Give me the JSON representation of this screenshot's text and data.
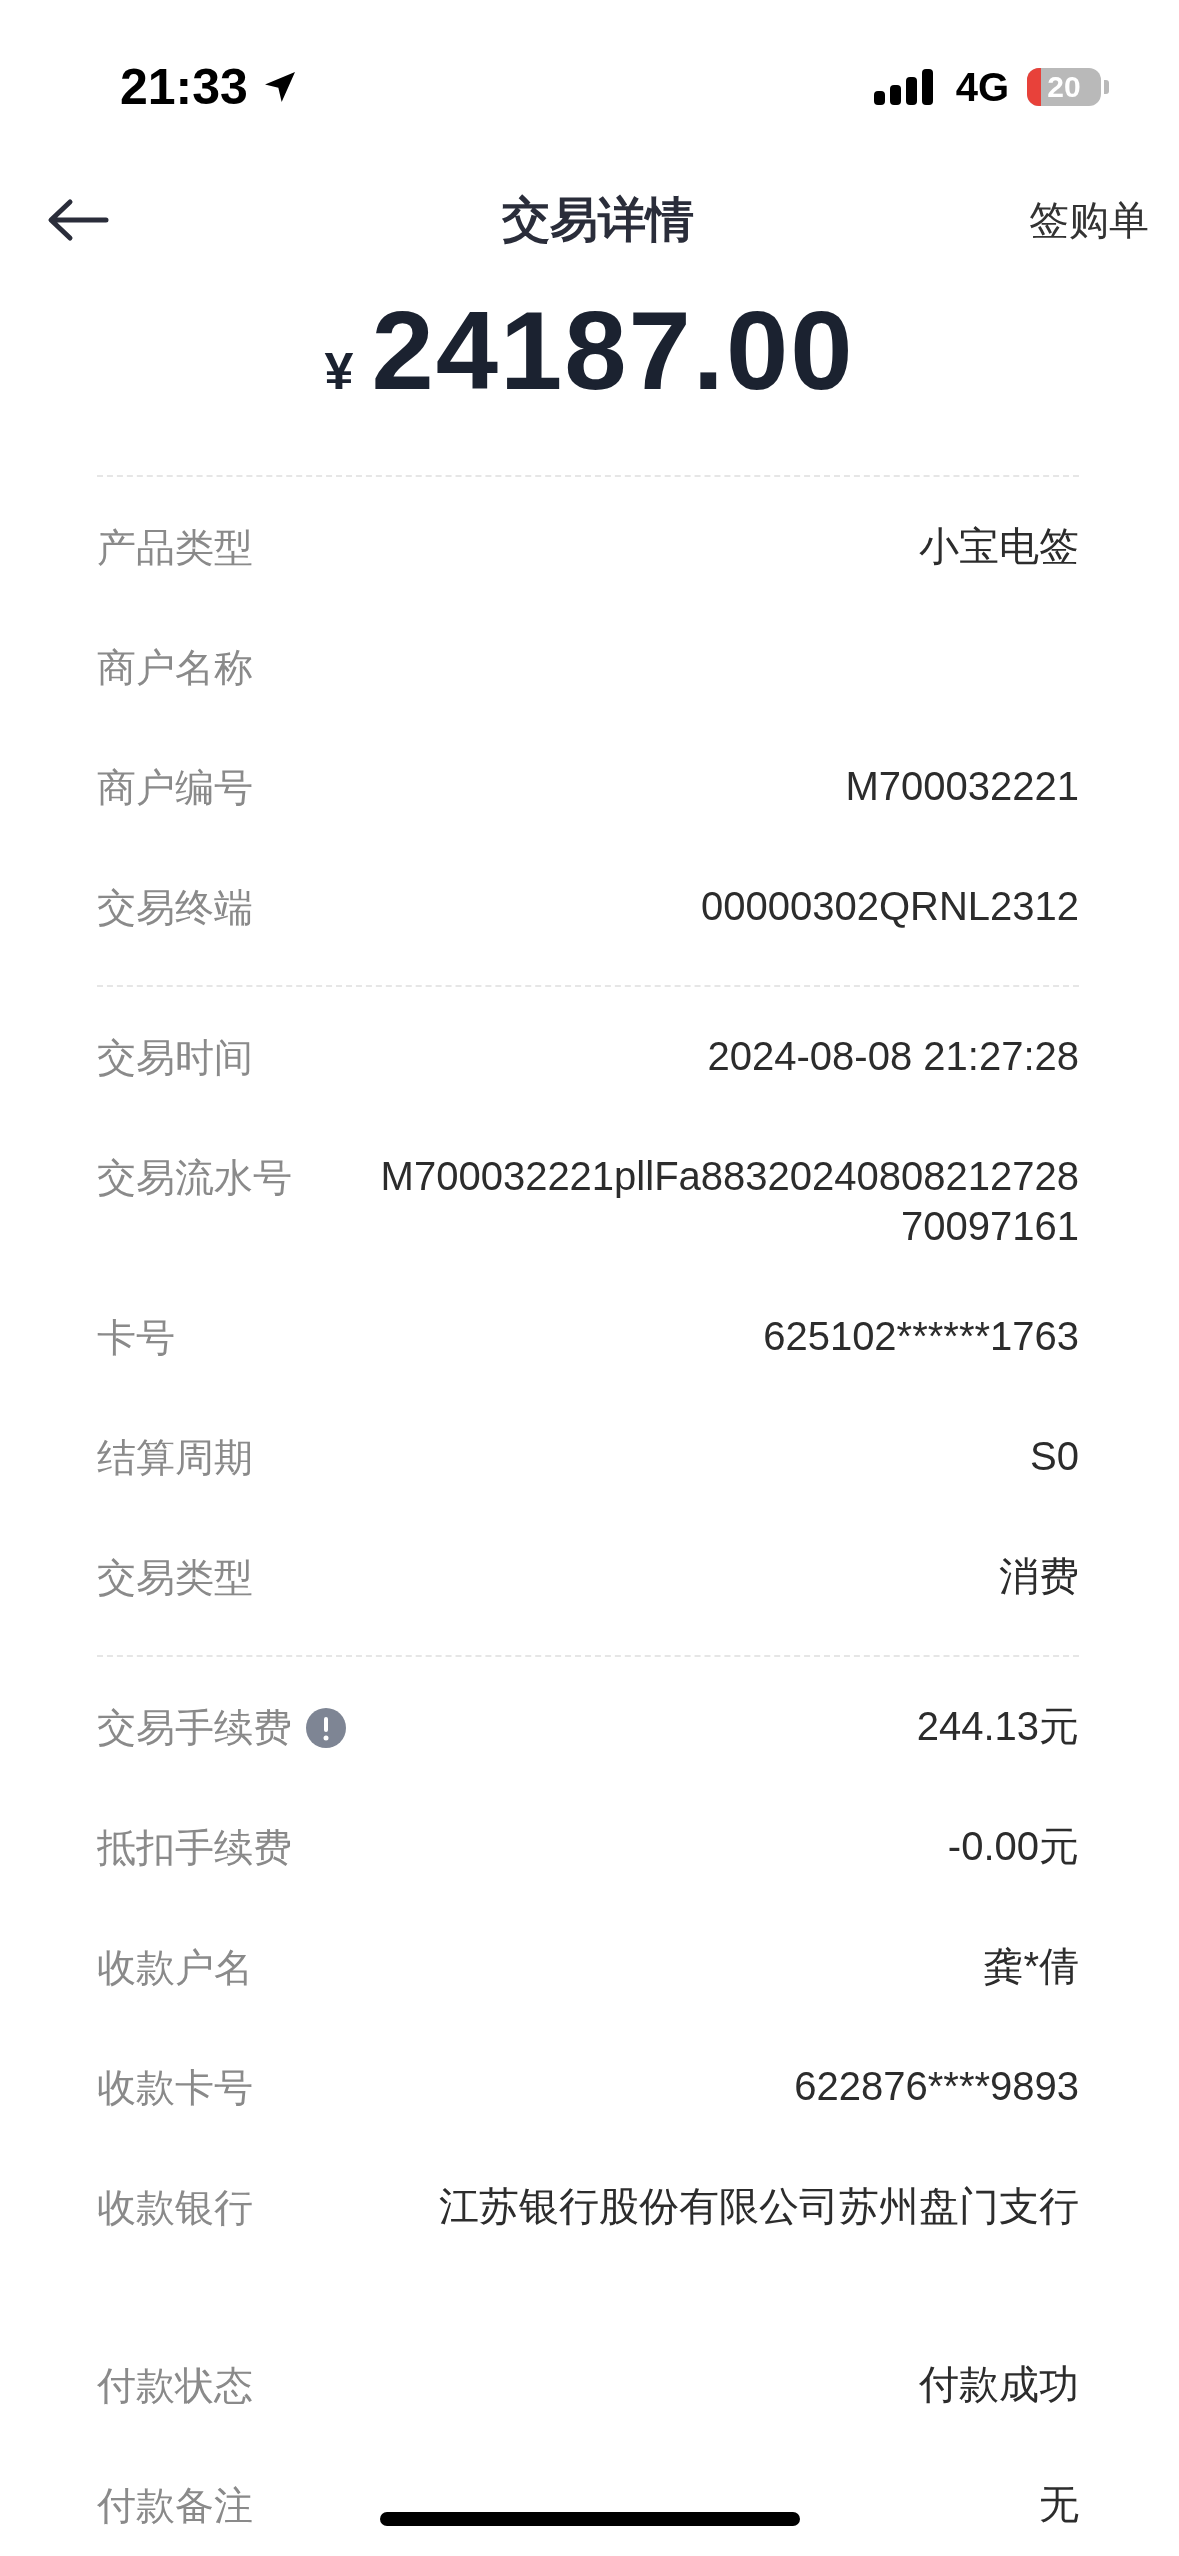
{
  "status_bar": {
    "time": "21:33",
    "network": "4G",
    "battery": "20"
  },
  "header": {
    "title": "交易详情",
    "action": "签购单"
  },
  "amount": {
    "currency": "¥",
    "value": "24187.00"
  },
  "sections": [
    {
      "divider": true,
      "rows": [
        {
          "label": "产品类型",
          "value": "小宝电签"
        },
        {
          "label": "商户名称"
        },
        {
          "label": "商户编号",
          "value": "M700032221"
        },
        {
          "label": "交易终端",
          "value": "00000302QRNL2312"
        }
      ]
    },
    {
      "divider": true,
      "rows": [
        {
          "label": "交易时间",
          "value": "2024-08-08 21:27:28"
        },
        {
          "label": "交易流水号",
          "value": "M700032221pllFa8832024080821272870097161"
        },
        {
          "label": "卡号",
          "value": "625102******1763"
        },
        {
          "label": "结算周期",
          "value": "S0"
        },
        {
          "label": "交易类型",
          "value": "消费"
        }
      ]
    },
    {
      "divider": true,
      "rows": [
        {
          "label": "交易手续费",
          "value": "244.13元",
          "info": true
        },
        {
          "label": "抵扣手续费",
          "value": "-0.00元"
        },
        {
          "label": "收款户名",
          "value": "龚*倩"
        },
        {
          "label": "收款卡号",
          "value": "622876****9893"
        },
        {
          "label": "收款银行",
          "value": "江苏银行股份有限公司苏州盘门支行"
        }
      ]
    },
    {
      "divider": false,
      "rows": [
        {
          "label": "付款状态",
          "value": "付款成功"
        },
        {
          "label": "付款备注",
          "value": "无"
        }
      ]
    }
  ]
}
